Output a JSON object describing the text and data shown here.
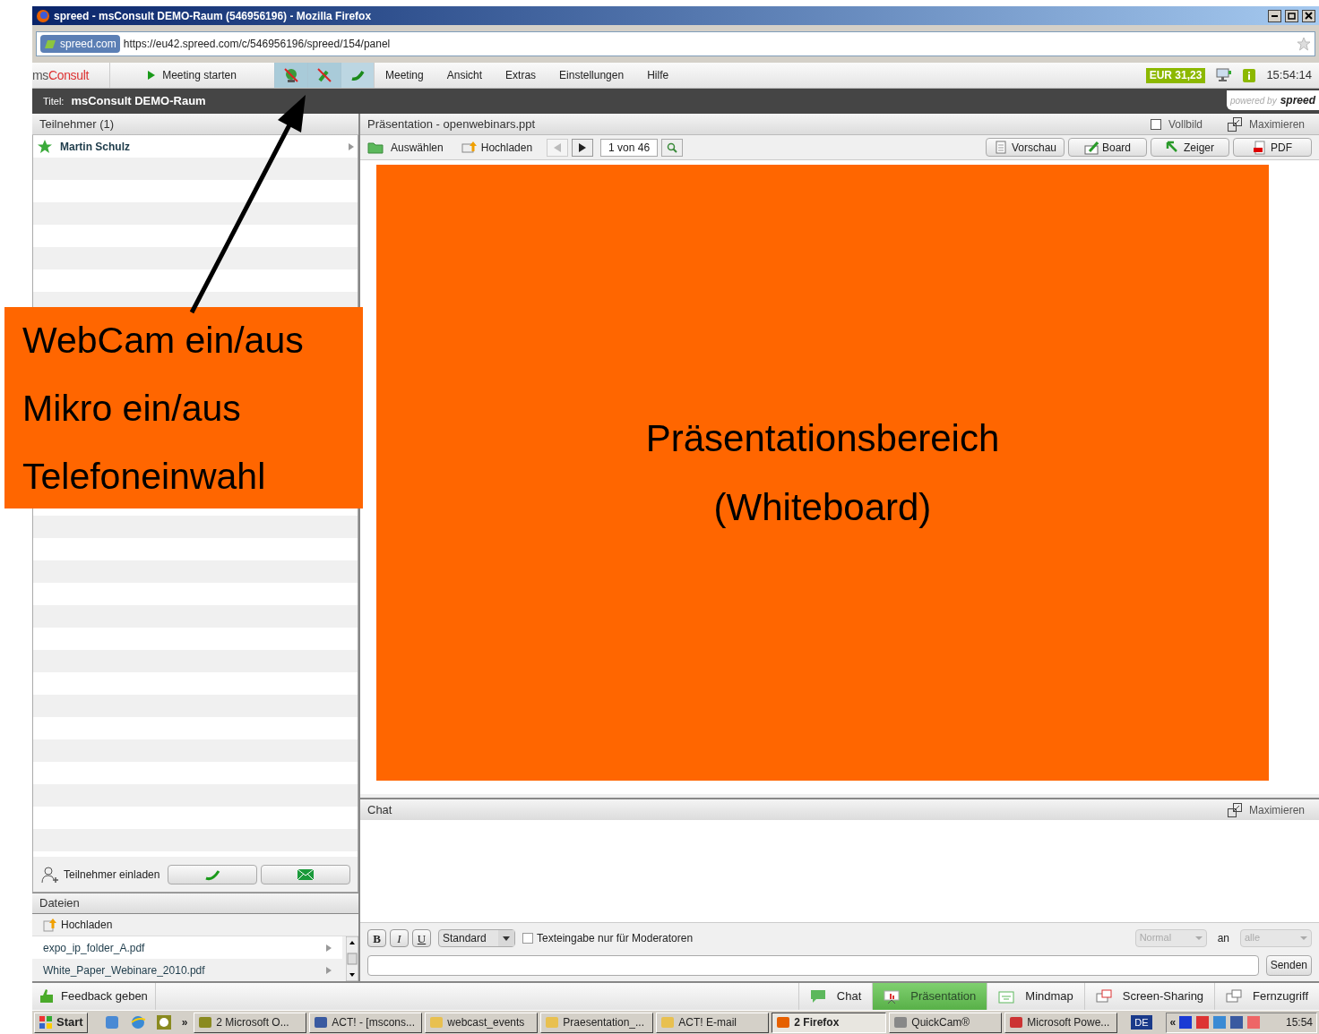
{
  "window": {
    "title": "spreed - msConsult DEMO-Raum (546956196) - Mozilla Firefox"
  },
  "address_bar": {
    "site_badge": "spreed.com",
    "url": "https://eu42.spreed.com/c/546956196/spreed/154/panel"
  },
  "app_toolbar": {
    "logo": "msConsult",
    "start_button": "Meeting starten",
    "media_buttons": [
      {
        "kind": "webcam",
        "on": false
      },
      {
        "kind": "mic",
        "on": false
      },
      {
        "kind": "phone",
        "on": true
      }
    ],
    "menu": [
      "Meeting",
      "Ansicht",
      "Extras",
      "Einstellungen",
      "Hilfe"
    ],
    "balance": "EUR 31,23",
    "clock": "15:54:14"
  },
  "title_strip": {
    "label": "Titel:",
    "value": "msConsult DEMO-Raum",
    "powered_by": "powered by",
    "brand": "spreed"
  },
  "participants": {
    "header": "Teilnehmer (1)",
    "items": [
      {
        "name": "Martin Schulz"
      }
    ],
    "invite": "Teilnehmer einladen"
  },
  "files": {
    "header": "Dateien",
    "upload": "Hochladen",
    "items": [
      "expo_ip_folder_A.pdf",
      "White_Paper_Webinare_2010.pdf"
    ]
  },
  "presentation": {
    "header": "Präsentation - openwebinars.ppt",
    "fullscreen": "Vollbild",
    "fullscreen_checked": false,
    "maximize": "Maximieren",
    "select": "Auswählen",
    "upload": "Hochladen",
    "page": "1 von 46",
    "tools": [
      "Vorschau",
      "Board",
      "Zeiger",
      "PDF"
    ],
    "area_lines": [
      "Präsentationsbereich",
      "(Whiteboard)"
    ]
  },
  "chat": {
    "header": "Chat",
    "maximize": "Maximieren",
    "bold": "B",
    "italic": "I",
    "underline": "U",
    "style": "Standard",
    "moderators_only": "Texteingabe nur für Moderatoren",
    "moderators_only_checked": false,
    "priority": "Normal",
    "to_label": "an",
    "recipient": "alle",
    "send": "Senden"
  },
  "feedback": "Feedback geben",
  "module_tabs": [
    {
      "label": "Chat",
      "selected": false
    },
    {
      "label": "Präsentation",
      "selected": true
    },
    {
      "label": "Mindmap",
      "selected": false
    },
    {
      "label": "Screen-Sharing",
      "selected": false
    },
    {
      "label": "Fernzugriff",
      "selected": false
    }
  ],
  "taskbar": {
    "start": "Start",
    "more": "»",
    "items": [
      {
        "label": "2 Microsoft O...",
        "selected": false
      },
      {
        "label": "ACT! - [mscons...",
        "selected": false
      },
      {
        "label": "webcast_events",
        "selected": false
      },
      {
        "label": "Praesentation_...",
        "selected": false
      },
      {
        "label": "ACT! E-mail",
        "selected": false
      },
      {
        "label": "2 Firefox",
        "selected": true
      },
      {
        "label": "QuickCam®",
        "selected": false
      },
      {
        "label": "Microsoft Powe...",
        "selected": false
      }
    ],
    "language": "DE",
    "tray_toggle": "«",
    "time": "15:54"
  },
  "callout": {
    "lines": [
      "WebCam ein/aus",
      "Mikro ein/aus",
      "Telefoneinwahl"
    ]
  }
}
